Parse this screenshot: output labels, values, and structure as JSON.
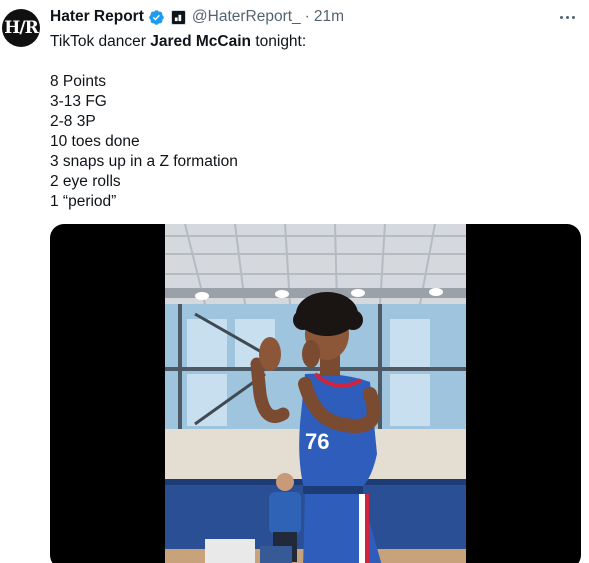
{
  "tweet": {
    "avatar_text": "H/R",
    "display_name": "Hater Report",
    "handle": "@HaterReport_",
    "separator": "·",
    "time": "21m",
    "intro_prefix": "TikTok dancer ",
    "intro_bold": "Jared McCain",
    "intro_suffix": " tonight:",
    "stats": [
      "8 Points",
      "3-13 FG",
      "2-8 3P",
      "10 toes done",
      "3 snaps up in a Z formation",
      "2 eye rolls",
      "1 “period”"
    ],
    "jersey_text": "76"
  },
  "colors": {
    "verified_blue": "#1d9bf0",
    "secondary_text": "#536471",
    "jersey_blue": "#2e5dbb",
    "jersey_red": "#d2233c"
  },
  "icons": [
    "verified-badge-icon",
    "affiliate-badge-icon",
    "more-options-icon"
  ]
}
